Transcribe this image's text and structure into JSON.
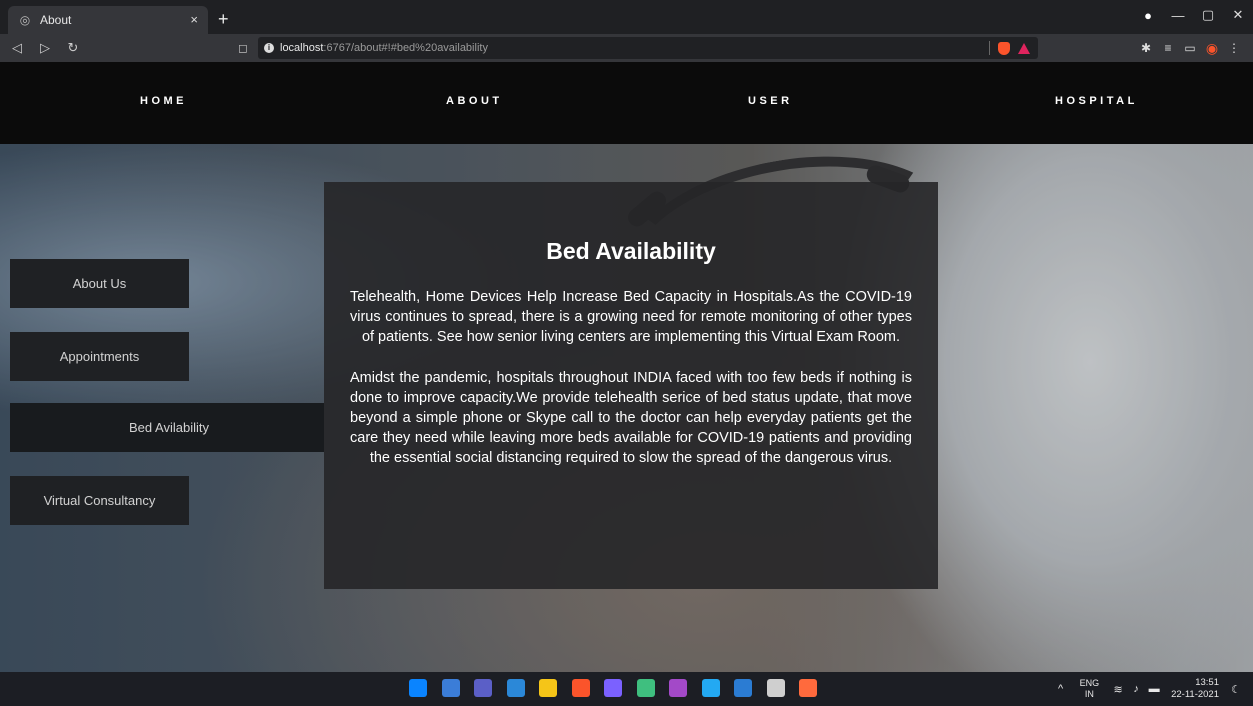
{
  "browser": {
    "tab_title": "About",
    "tab_close": "×",
    "new_tab": "+",
    "url_host": "localhost",
    "url_path": ":6767/about#!#bed%20availability"
  },
  "nav": {
    "items": [
      "HOME",
      "ABOUT",
      "USER",
      "HOSPITAL"
    ]
  },
  "sidebar": {
    "items": [
      {
        "label": "About Us"
      },
      {
        "label": "Appointments"
      },
      {
        "label": "Bed Avilability"
      },
      {
        "label": "Virtual Consultancy"
      }
    ],
    "active_index": 2
  },
  "content": {
    "title": "Bed Availability",
    "paragraphs": [
      "Telehealth, Home Devices Help Increase Bed Capacity in Hospitals.As the COVID-19 virus continues to spread, there is a growing need for remote monitoring of other types of patients. See how senior living centers are implementing this Virtual Exam Room.",
      "Amidst the pandemic, hospitals throughout INDIA faced with too few beds if nothing is done to improve capacity.We provide telehealth serice of bed status update, that move beyond a simple phone or Skype call to the doctor can help everyday patients get the care they need while leaving more beds available for COVID-19 patients and providing the essential social distancing required to slow the spread of the dangerous virus."
    ]
  },
  "taskbar": {
    "lang_top": "ENG",
    "lang_bottom": "IN",
    "time": "13:51",
    "date": "22-11-2021",
    "icon_colors": [
      "#0a84ff",
      "#3b7dd8",
      "#5b5fc7",
      "#2b88d8",
      "#f5c518",
      "#fb542b",
      "#7b61ff",
      "#3fbf7f",
      "#a349c8",
      "#23a9f2",
      "#2b7cd3",
      "#cfcfcf",
      "#ff6a3d"
    ]
  },
  "colors": {
    "nav_bg": "#0b0b0b",
    "card_bg": "#262628",
    "sidebar_bg": "#26292d"
  }
}
